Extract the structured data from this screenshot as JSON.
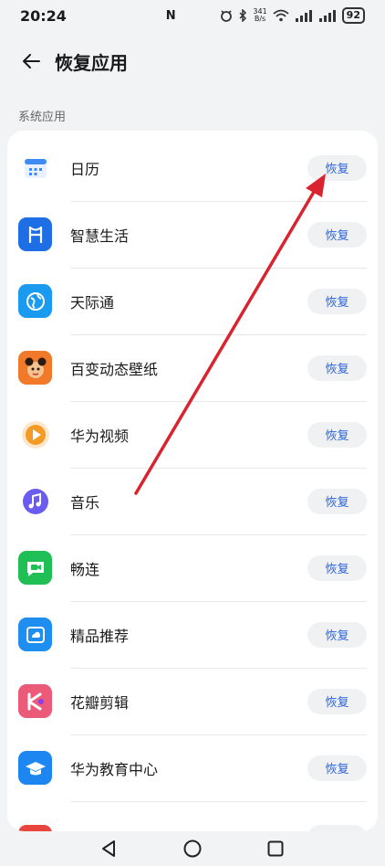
{
  "status_bar": {
    "time": "20:24",
    "nfc_label": "N",
    "net_speed_top": "341",
    "net_speed_bottom": "B/s",
    "battery": "92"
  },
  "header": {
    "title": "恢复应用",
    "back_icon": "arrow-left-icon"
  },
  "section_label": "系统应用",
  "apps": [
    {
      "name": "日历",
      "icon": "calendar-icon",
      "color": "#3d8cf5",
      "action": "恢复"
    },
    {
      "name": "智慧生活",
      "icon": "smart-life-icon",
      "color": "#1e6ee6",
      "action": "恢复"
    },
    {
      "name": "天际通",
      "icon": "globe-icon",
      "color": "#1a9bf0",
      "action": "恢复"
    },
    {
      "name": "百变动态壁纸",
      "icon": "wallpaper-icon",
      "color": "#f07a2a",
      "action": "恢复"
    },
    {
      "name": "华为视频",
      "icon": "video-play-icon",
      "color": "#f59a23",
      "action": "恢复"
    },
    {
      "name": "音乐",
      "icon": "music-note-icon",
      "color": "#5b5cf0",
      "action": "恢复"
    },
    {
      "name": "畅连",
      "icon": "chat-video-icon",
      "color": "#1fbf55",
      "action": "恢复"
    },
    {
      "name": "精品推荐",
      "icon": "cloud-store-icon",
      "color": "#1e8ef0",
      "action": "恢复"
    },
    {
      "name": "花瓣剪辑",
      "icon": "clip-editor-icon",
      "color": "#ec5a7a",
      "action": "恢复"
    },
    {
      "name": "华为教育中心",
      "icon": "graduation-cap-icon",
      "color": "#1e86f0",
      "action": "恢复"
    },
    {
      "name": "",
      "icon": "partial-app-icon",
      "color": "#e8453c",
      "action": ""
    }
  ],
  "annotation_color": "#d9232e"
}
